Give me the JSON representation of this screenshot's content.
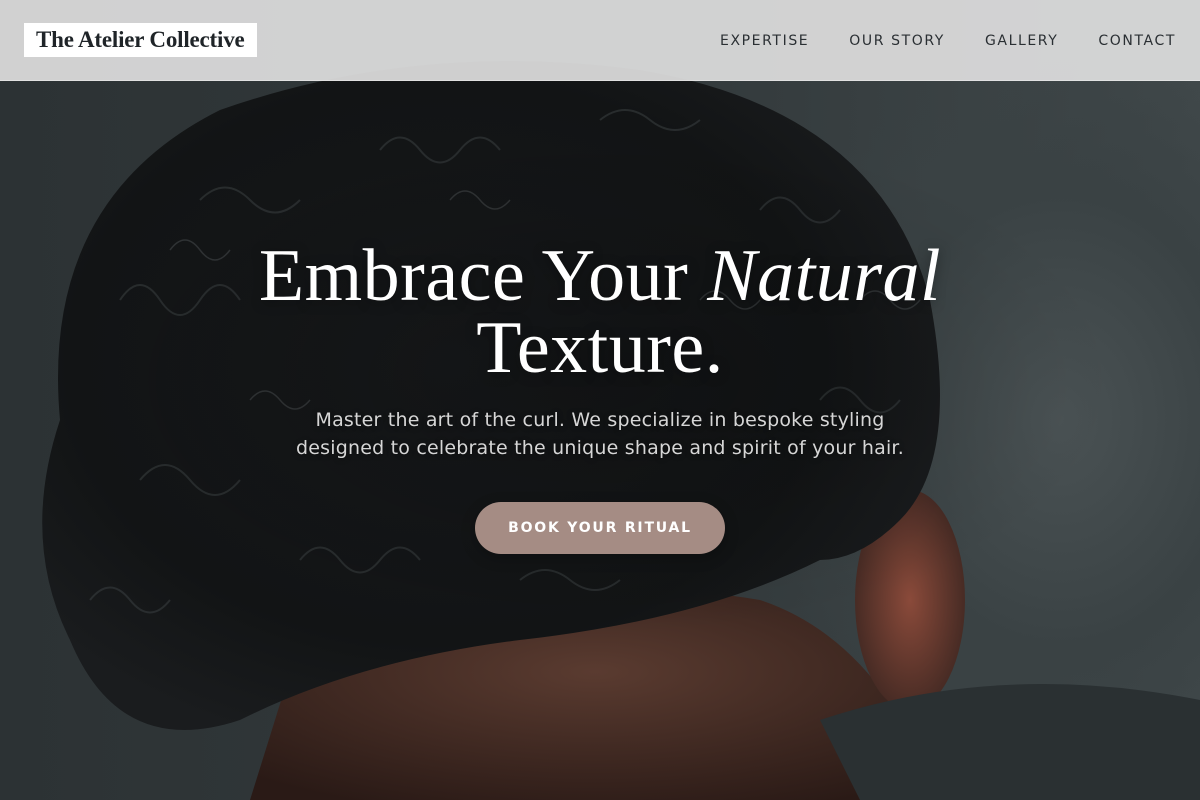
{
  "brand": {
    "name": "The Atelier Collective"
  },
  "nav": {
    "items": [
      {
        "label": "EXPERTISE"
      },
      {
        "label": "OUR STORY"
      },
      {
        "label": "GALLERY"
      },
      {
        "label": "CONTACT"
      }
    ]
  },
  "hero": {
    "headline_part1": "Embrace Your ",
    "headline_accent": "Natural",
    "headline_part2": "Texture.",
    "subtitle_line1": "Master the art of the curl. We specialize in bespoke styling",
    "subtitle_line2": "designed to celebrate the unique shape and spirit of your hair.",
    "cta_label": "BOOK YOUR RITUAL"
  },
  "colors": {
    "nav_background": "#dedede",
    "brand_box": "#ffffff",
    "cta_background": "#a58c84",
    "headline_text": "#ffffff"
  }
}
